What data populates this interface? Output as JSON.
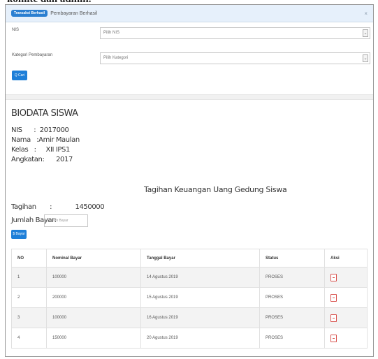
{
  "caption": "komite dan admin.",
  "panel": {
    "badge": "Transaksi Berhasil",
    "title": "Pembayaran Berhasil",
    "close": "×"
  },
  "form": {
    "nis_label": "NIS",
    "nis_value": "Pilih NIS",
    "kategori_label": "Kategori Pembayaran",
    "kategori_value": "Pilih Kategori",
    "arrow": "⌄",
    "cari_button": "Q Cari"
  },
  "biodata": {
    "title": "BIODATA SISWA",
    "nis_line": "NIS      :  2017000",
    "nama_line": "Nama   :Amir Maulan",
    "kelas_line": "Kelas   :     XII IPS1",
    "angkatan_line": "Angkatan:      2017"
  },
  "tagihan": {
    "title": "Tagihan Keuangan Uang Gedung Siswa",
    "tagihan_line": "Tagihan       :            1450000",
    "jumlah_label": "Jumlah Bayar:",
    "jumlah_placeholder": "Jumlah Bayar",
    "bayar_button": "$ Bayar"
  },
  "table": {
    "headers": [
      "NO",
      "Nominal Bayar",
      "Tanggal Bayar",
      "Status",
      "Aksi"
    ],
    "rows": [
      [
        "1",
        "100000",
        "14 Agustus 2019",
        "PROSES"
      ],
      [
        "2",
        "200000",
        "15 Agustus 2019",
        "PROSES"
      ],
      [
        "3",
        "100000",
        "16 Agustus 2019",
        "PROSES"
      ],
      [
        "4",
        "150000",
        "20 Agustus 2019",
        "PROSES"
      ]
    ]
  },
  "colors": {
    "primary": "#1e7fd8",
    "danger": "#d9534f",
    "panel_head": "#e6f0fb"
  }
}
